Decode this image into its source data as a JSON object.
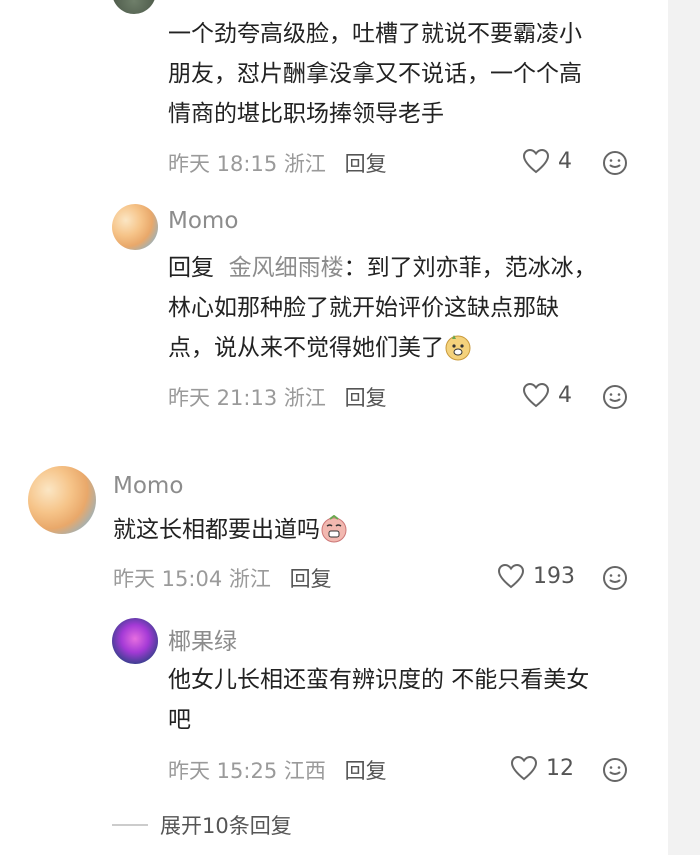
{
  "comments": [
    {
      "text_lines": [
        "一个劲夸高级脸，吐槽了就说不要霸凌小",
        "朋友，怼片酬拿没拿又不说话，一个个高",
        "情商的堪比职场捧领导老手"
      ],
      "time": "昨天 18:15",
      "location": "浙江",
      "reply_label": "回复",
      "likes": "4"
    },
    {
      "username": "Momo",
      "reply_prefix": "回复",
      "reply_target": "金风细雨楼",
      "text_lines": [
        "：到了刘亦菲，范冰冰，",
        "林心如那种脸了就开始评价这缺点那缺",
        "点，说从来不觉得她们美了"
      ],
      "time": "昨天 21:13",
      "location": "浙江",
      "reply_label": "回复",
      "likes": "4"
    },
    {
      "username": "Momo",
      "text_lines": [
        "就这长相都要出道吗"
      ],
      "time": "昨天 15:04",
      "location": "浙江",
      "reply_label": "回复",
      "likes": "193"
    },
    {
      "username": "椰果绿",
      "text_lines": [
        "他女儿长相还蛮有辨识度的 不能只看美女",
        "吧"
      ],
      "time": "昨天 15:25",
      "location": "江西",
      "reply_label": "回复",
      "likes": "12"
    }
  ],
  "expand_label": "展开10条回复"
}
